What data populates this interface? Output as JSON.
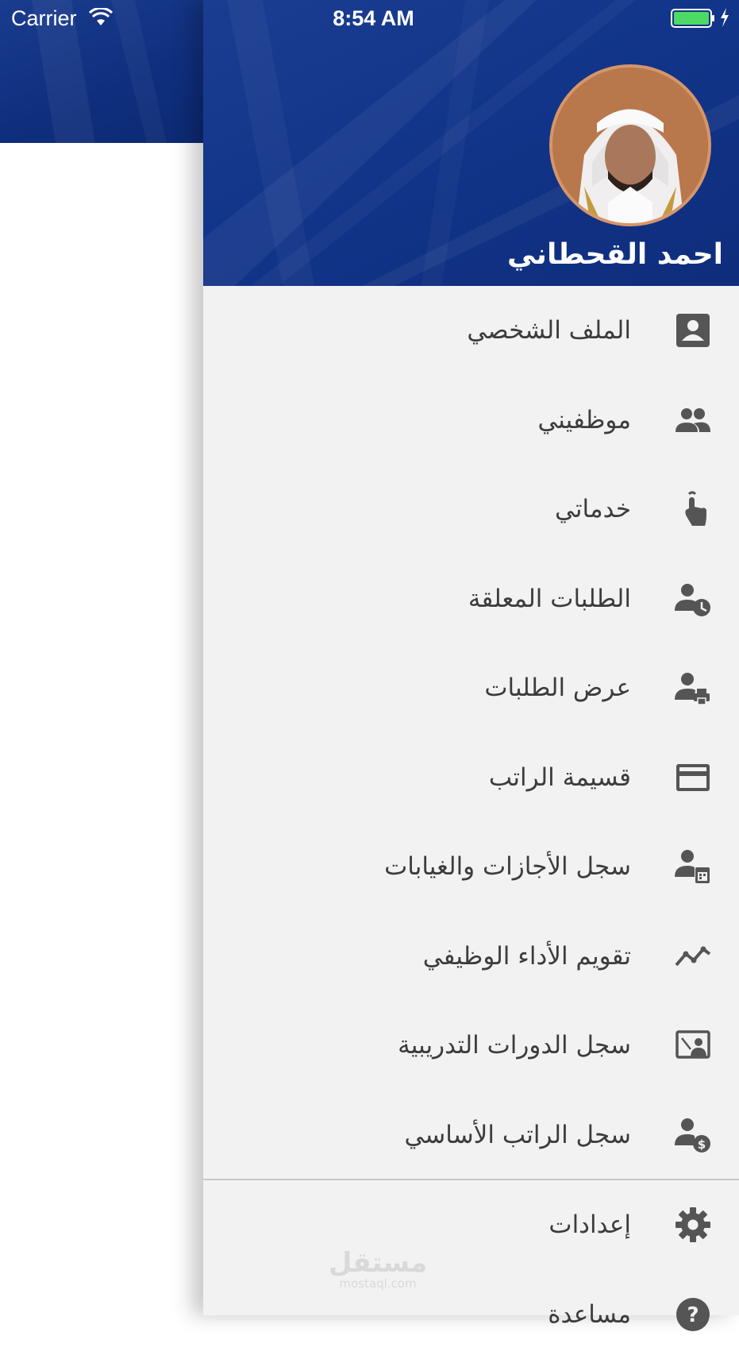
{
  "status_bar": {
    "carrier": "Carrier",
    "time": "8:54 AM",
    "battery_color": "#4cd964"
  },
  "drawer": {
    "user_name": "احمد القحطاني",
    "menu_items": [
      {
        "label": "الملف الشخصي",
        "icon": "profile-card-icon"
      },
      {
        "label": "موظفيني",
        "icon": "people-icon"
      },
      {
        "label": "خدماتي",
        "icon": "touch-icon"
      },
      {
        "label": "الطلبات المعلقة",
        "icon": "person-clock-icon"
      },
      {
        "label": "عرض الطلبات",
        "icon": "person-print-icon"
      },
      {
        "label": "قسيمة الراتب",
        "icon": "credit-card-icon"
      },
      {
        "label": "سجل الأجازات والغيابات",
        "icon": "person-calendar-icon"
      },
      {
        "label": "تقويم الأداء الوظيفي",
        "icon": "trending-icon"
      },
      {
        "label": "سجل الدورات التدريبية",
        "icon": "presentation-icon"
      },
      {
        "label": "سجل الراتب الأساسي",
        "icon": "person-dollar-icon"
      }
    ],
    "settings_items": [
      {
        "label": "إعدادات",
        "icon": "gear-icon"
      },
      {
        "label": "مساعدة",
        "icon": "help-icon"
      }
    ]
  },
  "watermark": {
    "arabic": "مستقل",
    "latin": "mostaql.com"
  },
  "colors": {
    "header_blue": "#12358a",
    "drawer_bg": "#f2f2f2",
    "icon_gray": "#555555",
    "text_gray": "#3c3c3c"
  }
}
